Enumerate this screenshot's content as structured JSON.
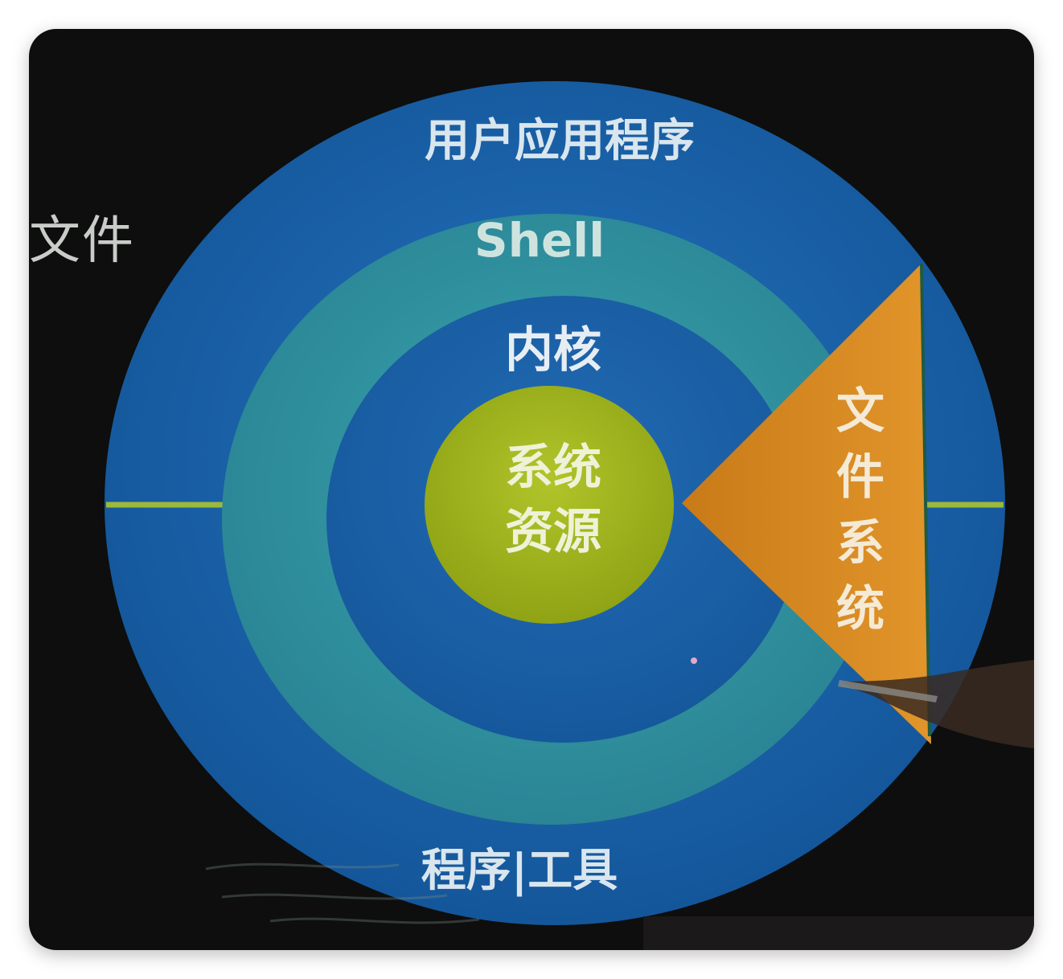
{
  "side_caption": "文件",
  "layers": {
    "outer_top": "用户应用程序",
    "shell": "Shell",
    "kernel": "内核",
    "core_line1": "系统",
    "core_line2": "资源",
    "outer_bottom": "程序|工具"
  },
  "wedge_label": [
    "文",
    "件",
    "系",
    "统"
  ],
  "colors": {
    "background": "#0d0e0d",
    "outer_ring": "#1a5fa6",
    "shell_ring": "#2f8f9c",
    "kernel_ring": "#1b5ea3",
    "core": "#9fb31c",
    "wedge": "#d2861e",
    "divider": "#9cb93a",
    "label": "#d9e6ee"
  }
}
